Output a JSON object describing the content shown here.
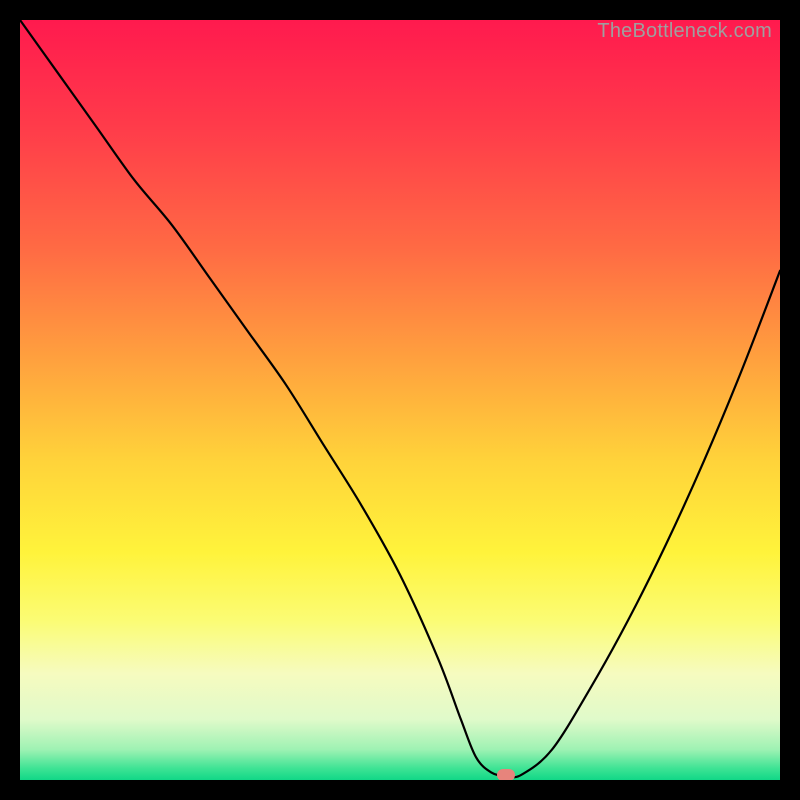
{
  "watermark": "TheBottleneck.com",
  "chart_data": {
    "type": "line",
    "title": "",
    "xlabel": "",
    "ylabel": "",
    "xlim": [
      0,
      100
    ],
    "ylim": [
      0,
      100
    ],
    "grid": false,
    "legend": false,
    "gradient_stops": [
      {
        "pct": 0,
        "color": "#ff1a4e"
      },
      {
        "pct": 14,
        "color": "#ff3b4a"
      },
      {
        "pct": 30,
        "color": "#ff6a44"
      },
      {
        "pct": 45,
        "color": "#ffa23e"
      },
      {
        "pct": 58,
        "color": "#ffd33a"
      },
      {
        "pct": 70,
        "color": "#fff33b"
      },
      {
        "pct": 79,
        "color": "#fbfc74"
      },
      {
        "pct": 86,
        "color": "#f6fbbf"
      },
      {
        "pct": 92,
        "color": "#e0faca"
      },
      {
        "pct": 96,
        "color": "#9ef2b3"
      },
      {
        "pct": 98.5,
        "color": "#3de394"
      },
      {
        "pct": 100,
        "color": "#11d787"
      }
    ],
    "series": [
      {
        "name": "bottleneck-curve",
        "stroke": "#000000",
        "stroke_width": 2.2,
        "x": [
          0,
          5,
          10,
          15,
          20,
          25,
          30,
          35,
          40,
          45,
          50,
          55,
          58,
          60,
          62,
          64,
          66,
          70,
          75,
          80,
          85,
          90,
          95,
          100
        ],
        "values": [
          100,
          93,
          86,
          79,
          73,
          66,
          59,
          52,
          44,
          36,
          27,
          16,
          8,
          3,
          1,
          0.5,
          0.7,
          4,
          12,
          21,
          31,
          42,
          54,
          67
        ]
      }
    ],
    "marker": {
      "x": 64,
      "y": 0.6,
      "color": "#e7847c"
    }
  }
}
